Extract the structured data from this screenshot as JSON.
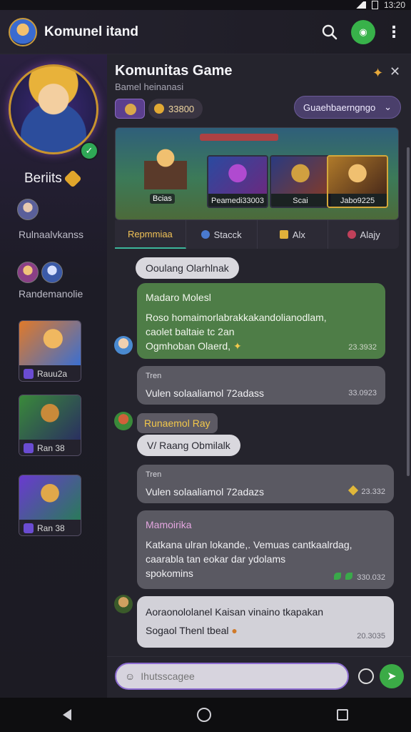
{
  "status_bar": {
    "time": "13:20"
  },
  "app_bar": {
    "title": "Komunel itand"
  },
  "sidebar": {
    "profile_name": "Beriits",
    "group_1_label": "Rulnaalvkanss",
    "group_2_label": "Randemanolie",
    "hero_cards": [
      {
        "label": "Rauu2a"
      },
      {
        "label": "Ran 38"
      },
      {
        "label": "Ran 38"
      }
    ]
  },
  "panel": {
    "title": "Komunitas Game",
    "subtitle": "Bamel heinanasi",
    "coins": "33800",
    "dropdown_label": "Guaehbaerngngo",
    "banner_cards": [
      {
        "label": "Bcias"
      },
      {
        "label": "Peamedi33003"
      },
      {
        "label": "Scai"
      },
      {
        "label": "Jabo9225"
      }
    ],
    "tabs": [
      {
        "label": "Repmmiaa"
      },
      {
        "label": "Stacck"
      },
      {
        "label": "Alx"
      },
      {
        "label": "Alajy"
      }
    ]
  },
  "chat": {
    "pill_1": "Ooulang Olarhlnak",
    "msg_1": {
      "title": "Madaro Molesl",
      "line1": "Roso homaimorlabrakkakandolianodlam,",
      "line2": "caolet baltaie tc 2an",
      "line3": "Ogmhoban Olaerd,",
      "time": "23.3932"
    },
    "msg_2": {
      "small": "Tren",
      "text": "Vulen solaaliamol 72adass",
      "time": "33.0923"
    },
    "gold_label": "Runaemol Ray",
    "pill_2": "V/ Raang Obmilalk",
    "msg_3": {
      "small": "Tren",
      "text": "Vulen solaaliamol 72adazs",
      "time": "23.332"
    },
    "msg_4": {
      "title": "Mamoirika",
      "line1": "Katkana ulran lokande,. Vemuas cantkaalrdag,",
      "line2": "caarabla tan eokar dar ydolams",
      "line3": "spokomins",
      "time": "330.032"
    },
    "msg_5": {
      "line1": "Aoraonololanel Kaisan vinaino tkapakan",
      "line2": "Sogaol Thenl tbeal",
      "time": "20.3035"
    }
  },
  "composer": {
    "placeholder": "Ihutsscagee"
  },
  "colors": {
    "accent_green": "#3bab46",
    "accent_purple": "#8c6bd0",
    "gold": "#e0a52b"
  }
}
